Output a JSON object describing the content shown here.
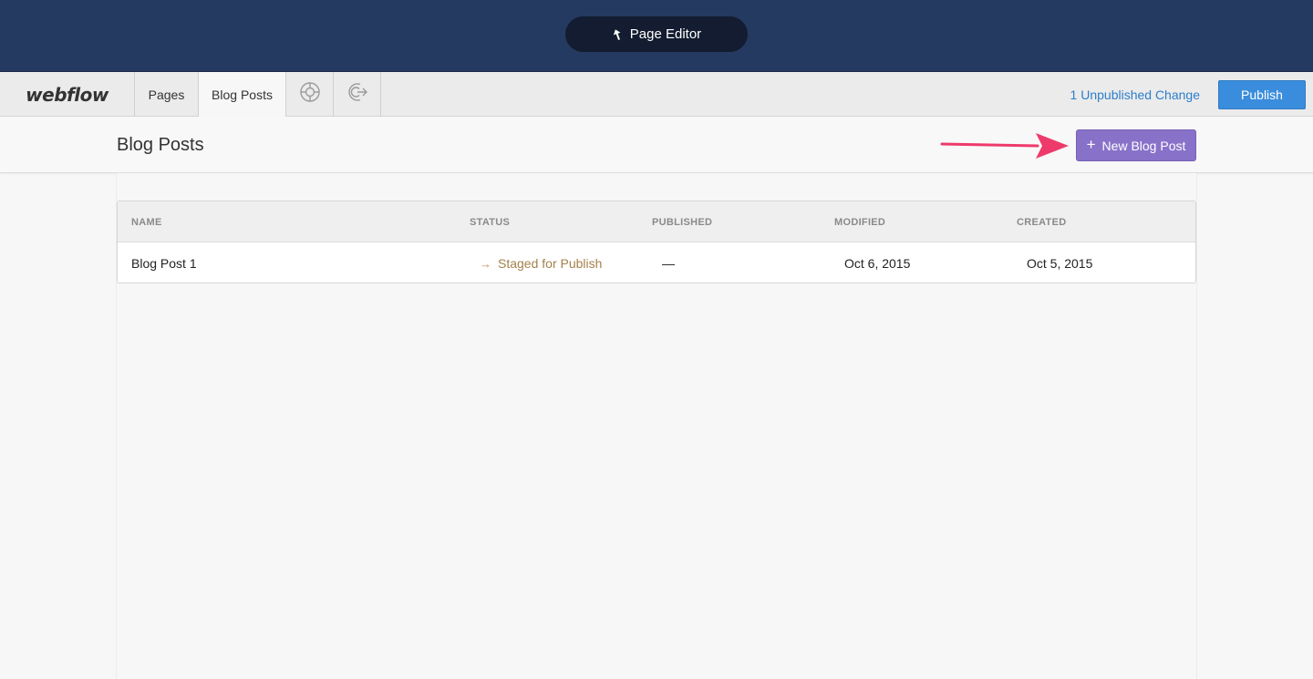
{
  "topbar": {
    "page_editor_label": "Page Editor"
  },
  "nav": {
    "logo": "webflow",
    "tabs": [
      {
        "label": "Pages"
      },
      {
        "label": "Blog Posts",
        "active": true
      }
    ],
    "icons": [
      "help-icon",
      "logout-icon"
    ],
    "unpublished_label": "1 Unpublished Change",
    "publish_label": "Publish"
  },
  "header": {
    "title": "Blog Posts",
    "new_post_label": "New Blog Post"
  },
  "table": {
    "columns": [
      "NAME",
      "STATUS",
      "PUBLISHED",
      "MODIFIED",
      "CREATED"
    ],
    "rows": [
      {
        "name": "Blog Post 1",
        "status": "Staged for Publish",
        "published": "—",
        "modified": "Oct 6, 2015",
        "created": "Oct 5, 2015"
      }
    ]
  },
  "colors": {
    "topbar": "#253a61",
    "publish": "#3a8ddc",
    "new_post": "#8872c9",
    "status": "#a5804a",
    "link": "#2d7ecb",
    "annotation_arrow": "#ee3a6a"
  }
}
